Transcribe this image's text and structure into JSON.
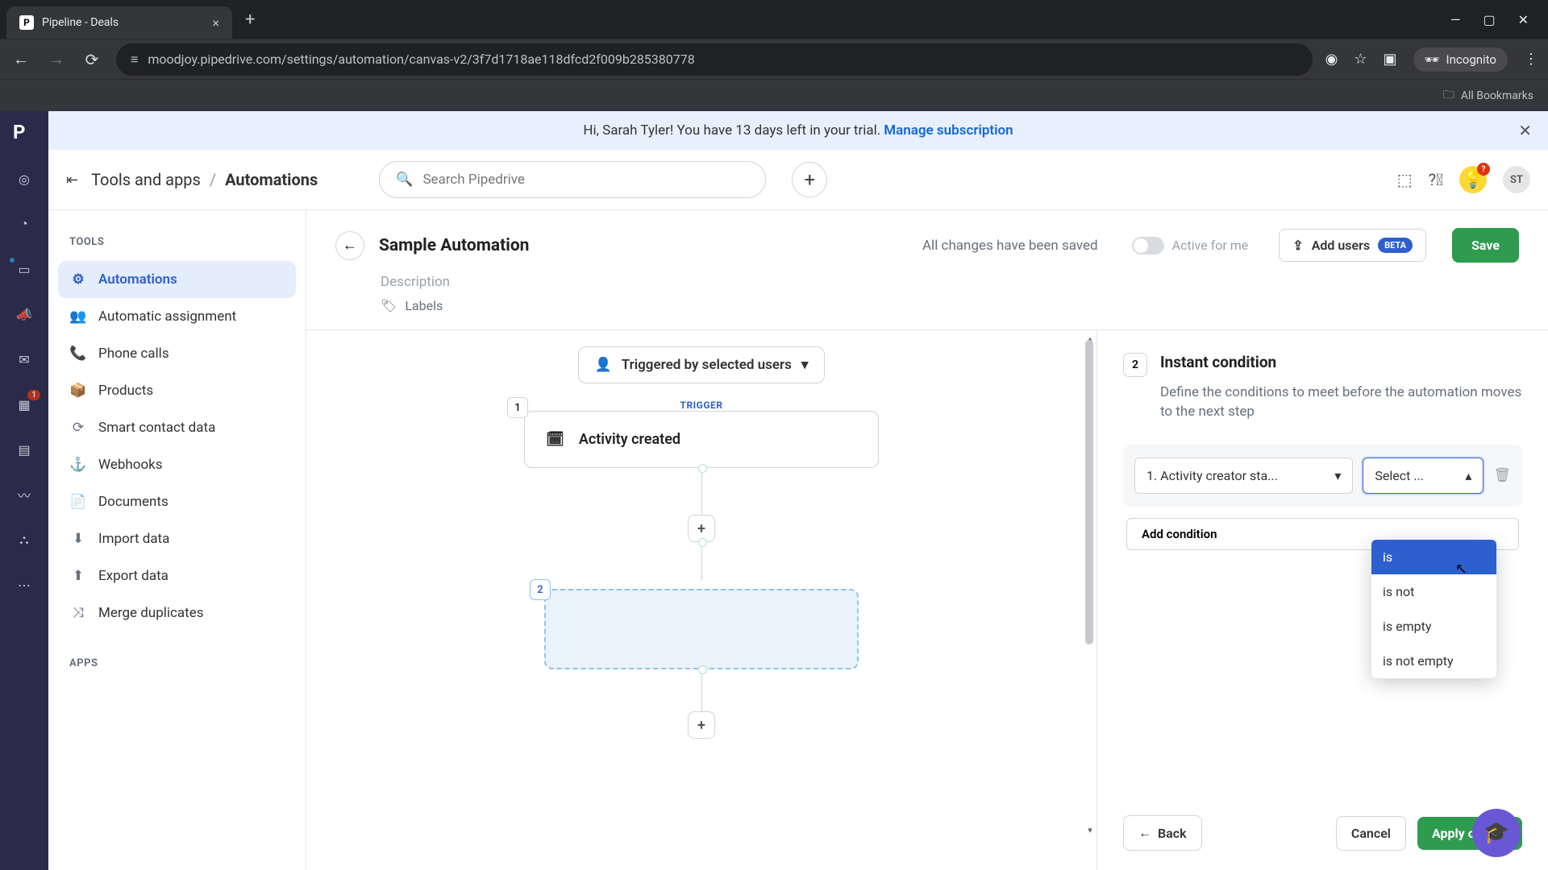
{
  "browser": {
    "tab_title": "Pipeline - Deals",
    "url": "moodjoy.pipedrive.com/settings/automation/canvas-v2/3f7d1718ae118dfcd2f009b285380778",
    "incognito_label": "Incognito",
    "bookmarks_label": "All Bookmarks"
  },
  "banner": {
    "text": "Hi, Sarah Tyler! You have 13 days left in your trial.",
    "link": "Manage subscription"
  },
  "header": {
    "crumb_parent": "Tools and apps",
    "crumb_current": "Automations",
    "search_placeholder": "Search Pipedrive",
    "avatar_initials": "ST",
    "bulb_badge": "?"
  },
  "sidebar": {
    "heading_tools": "TOOLS",
    "heading_apps": "APPS",
    "items": [
      {
        "label": "Automations"
      },
      {
        "label": "Automatic assignment"
      },
      {
        "label": "Phone calls"
      },
      {
        "label": "Products"
      },
      {
        "label": "Smart contact data"
      },
      {
        "label": "Webhooks"
      },
      {
        "label": "Documents"
      },
      {
        "label": "Import data"
      },
      {
        "label": "Export data"
      },
      {
        "label": "Merge duplicates"
      }
    ]
  },
  "page": {
    "title": "Sample Automation",
    "description_placeholder": "Description",
    "labels_label": "Labels",
    "save_status": "All changes have been saved",
    "toggle_label": "Active for me",
    "add_users_label": "Add users",
    "beta_label": "BETA",
    "save_label": "Save"
  },
  "canvas": {
    "triggered_label": "Triggered by selected users",
    "trigger_tag": "TRIGGER",
    "step1_num": "1",
    "step1_label": "Activity created",
    "step2_num": "2"
  },
  "panel": {
    "step_num": "2",
    "title": "Instant condition",
    "description": "Define the conditions to meet before the automation moves to the next step",
    "field_dd": "1. Activity creator sta...",
    "operator_dd": "Select ...",
    "add_condition_label": "Add condition",
    "options": [
      "is",
      "is not",
      "is empty",
      "is not empty"
    ],
    "back_label": "Back",
    "cancel_label": "Cancel",
    "apply_label": "Apply cond..."
  },
  "rail_badge": "1"
}
